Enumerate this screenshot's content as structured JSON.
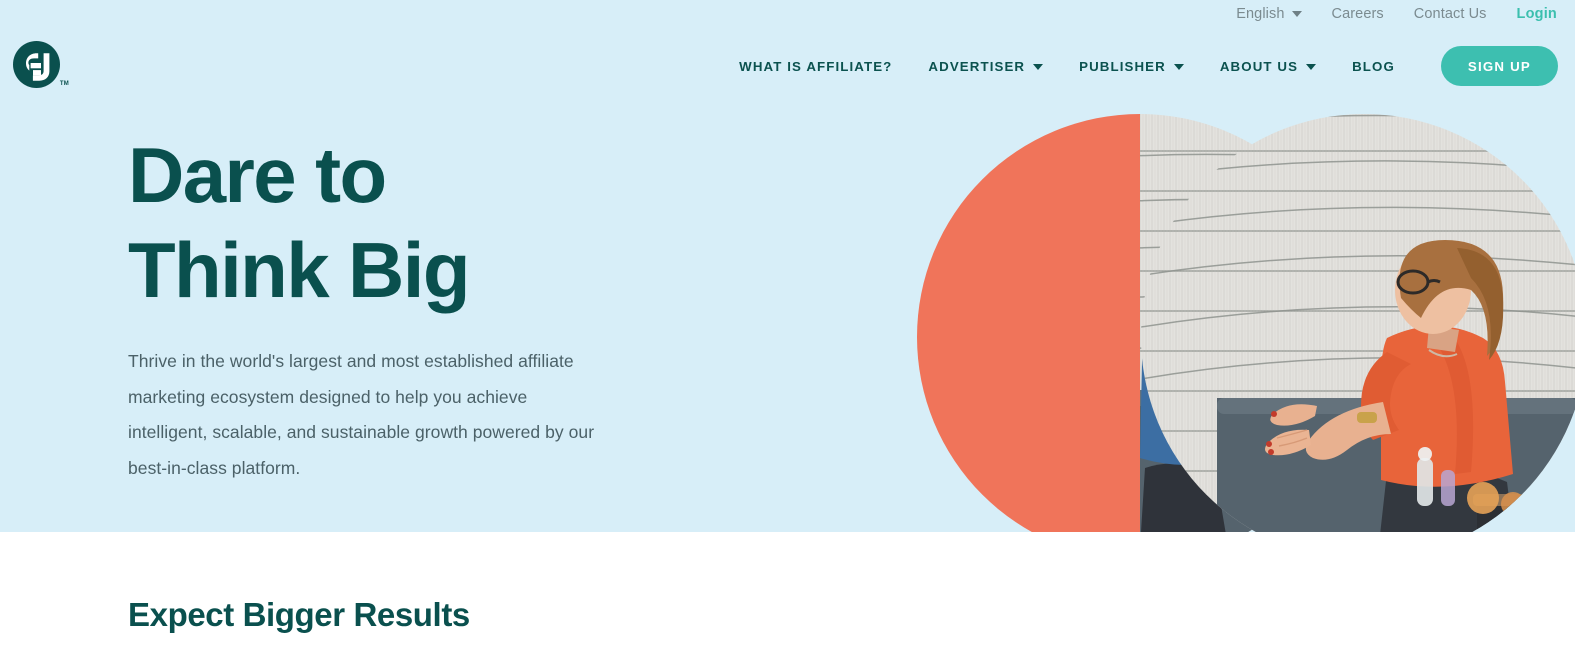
{
  "brand": {
    "logo_icon": "cj-monogram-logo",
    "logo_alt": "CJ",
    "trademark": "TM"
  },
  "colors": {
    "hero_background": "#d7eef8",
    "dark_teal": "#0a504e",
    "accent_teal": "#3dbfb0",
    "coral": "#f0745a",
    "body_text": "#4b6168",
    "utility_text": "#7b8b90",
    "white": "#ffffff"
  },
  "utility_nav": {
    "language": "English",
    "language_caret_icon": "chevron-down-icon",
    "links": [
      {
        "label": "Careers"
      },
      {
        "label": "Contact Us"
      }
    ],
    "login": "Login"
  },
  "main_nav": {
    "items": [
      {
        "label": "WHAT IS AFFILIATE?",
        "has_dropdown": false
      },
      {
        "label": "ADVERTISER",
        "has_dropdown": true
      },
      {
        "label": "PUBLISHER",
        "has_dropdown": true
      },
      {
        "label": "ABOUT US",
        "has_dropdown": true
      },
      {
        "label": "BLOG",
        "has_dropdown": false
      }
    ],
    "cta": "SIGN UP"
  },
  "hero": {
    "title_line1": "Dare to",
    "title_line2": "Think Big",
    "subtitle": "Thrive in the world's largest and most established affiliate marketing ecosystem designed to help you achieve intelligent, scalable, and sustainable growth powered by our best-in-class platform.",
    "art": {
      "left_circle": {
        "left_half": "coral-fill",
        "right_half": "photo-man-in-denim-shirt-seated-talking"
      },
      "right_circle": {
        "photo": "photo-woman-in-orange-top-seated-gesturing"
      }
    }
  },
  "section": {
    "heading": "Expect Bigger Results"
  }
}
